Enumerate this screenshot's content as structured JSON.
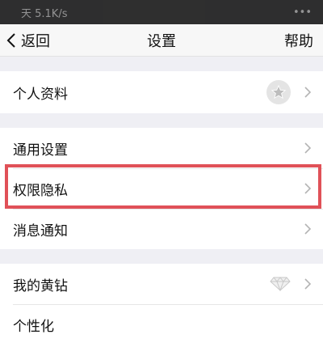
{
  "status_bar": {
    "left_text": "天 5.1K/s",
    "right_text": "•••"
  },
  "nav": {
    "back_label": "返回",
    "title": "设置",
    "help_label": "帮助"
  },
  "sections": {
    "profile": {
      "label": "个人资料"
    },
    "general": {
      "label": "通用设置"
    },
    "privacy": {
      "label": "权限隐私"
    },
    "notifications": {
      "label": "消息通知"
    },
    "yellow_diamond": {
      "label": "我的黄钻"
    },
    "personalize": {
      "label": "个性化"
    }
  },
  "colors": {
    "highlight": "#e05158",
    "background": "#efeff4"
  }
}
